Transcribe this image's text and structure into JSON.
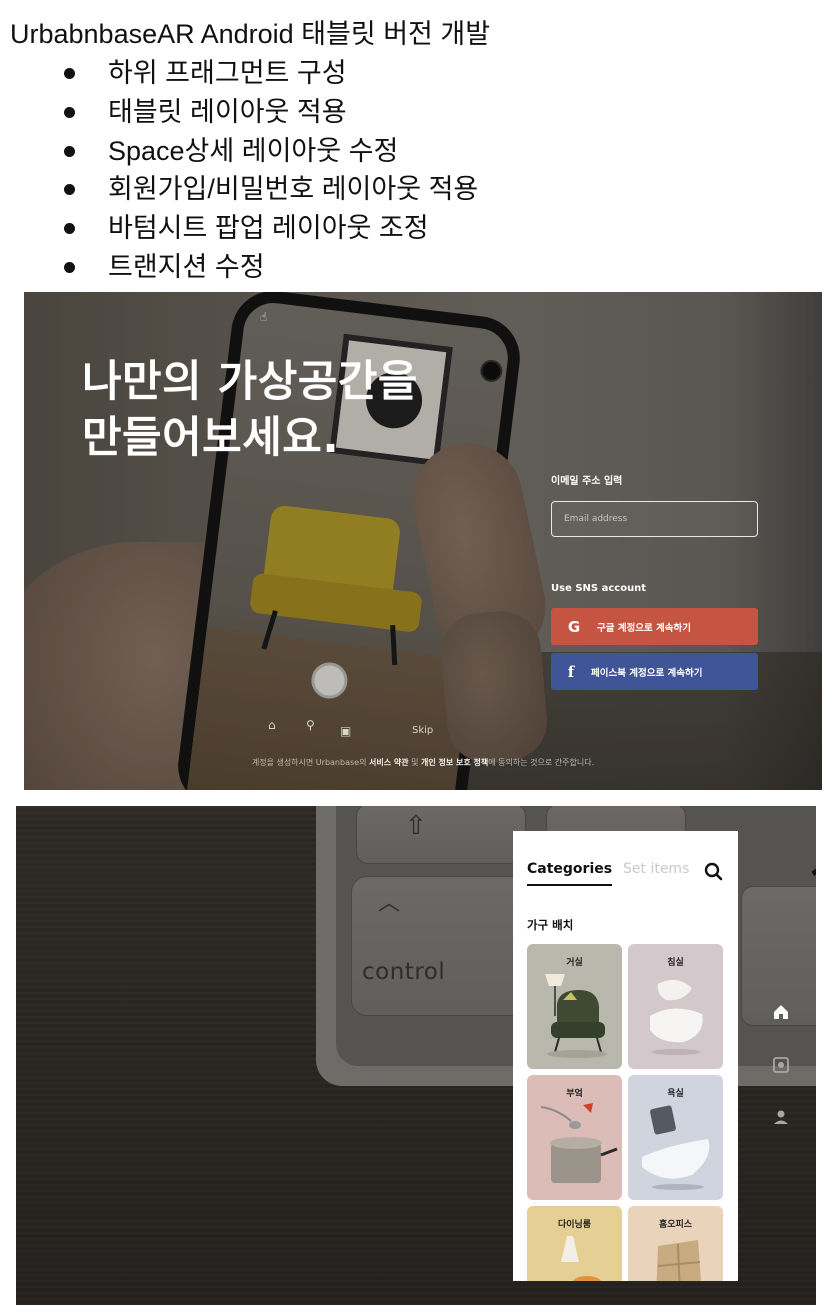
{
  "doc": {
    "title": "UrbabnbaseAR Android 태블릿 버전 개발",
    "bullets": [
      "하위 프래그먼트 구성",
      "태블릿 레이아웃 적용",
      "Space상세 레이아웃 수정",
      "회원가입/비밀번호 레이아웃 적용",
      "바텀시트 팝업 레이아웃 조정",
      "트랜지션 수정"
    ]
  },
  "landing": {
    "headline_line1": "나만의 가상공간을",
    "headline_line2": "만들어보세요.",
    "email_label": "이메일 주소 입력",
    "email_placeholder": "Email address",
    "email_value": "",
    "sns_label": "Use SNS account",
    "google_icon": "G",
    "google_button": "구글 계정으로 계속하기",
    "facebook_icon": "f",
    "facebook_button": "페이스북 계정으로 계속하기",
    "skip": "Skip",
    "terms_prefix": "계정을 생성하시면 Urbanbase의 ",
    "terms_service": "서비스 약관",
    "terms_and": " 및 ",
    "terms_privacy": "개인 정보 보호 정책",
    "terms_suffix": "에 동의하는 것으로 간주합니다.",
    "icons": {
      "hand": "hand-pointer-icon",
      "home": "home-icon",
      "search": "search-icon",
      "box": "box-icon"
    }
  },
  "catalog": {
    "keyboard_label": "control",
    "tabs": [
      {
        "label": "Categories",
        "active": true
      },
      {
        "label": "Set items",
        "active": false
      }
    ],
    "section_title": "가구 배치",
    "categories": [
      {
        "name": "거실",
        "bg": "#b9b8ac",
        "icon": "armchair-icon"
      },
      {
        "name": "침실",
        "bg": "#d3c9cd",
        "icon": "pillow-icon"
      },
      {
        "name": "부엌",
        "bg": "#dcbcb7",
        "icon": "pot-icon"
      },
      {
        "name": "욕실",
        "bg": "#cfd4de",
        "icon": "bathtub-icon"
      },
      {
        "name": "다이닝룸",
        "bg": "#e6cf95",
        "icon": "dining-icon"
      },
      {
        "name": "홈오피스",
        "bg": "#e9d3bb",
        "icon": "shelf-icon"
      }
    ],
    "side_nav": [
      "home-icon",
      "ar-scan-icon",
      "user-icon"
    ],
    "colors": {
      "google": "#c65443",
      "facebook": "#3f5597",
      "tab_active": "#111111",
      "tab_inactive": "#c9c9c9"
    }
  }
}
